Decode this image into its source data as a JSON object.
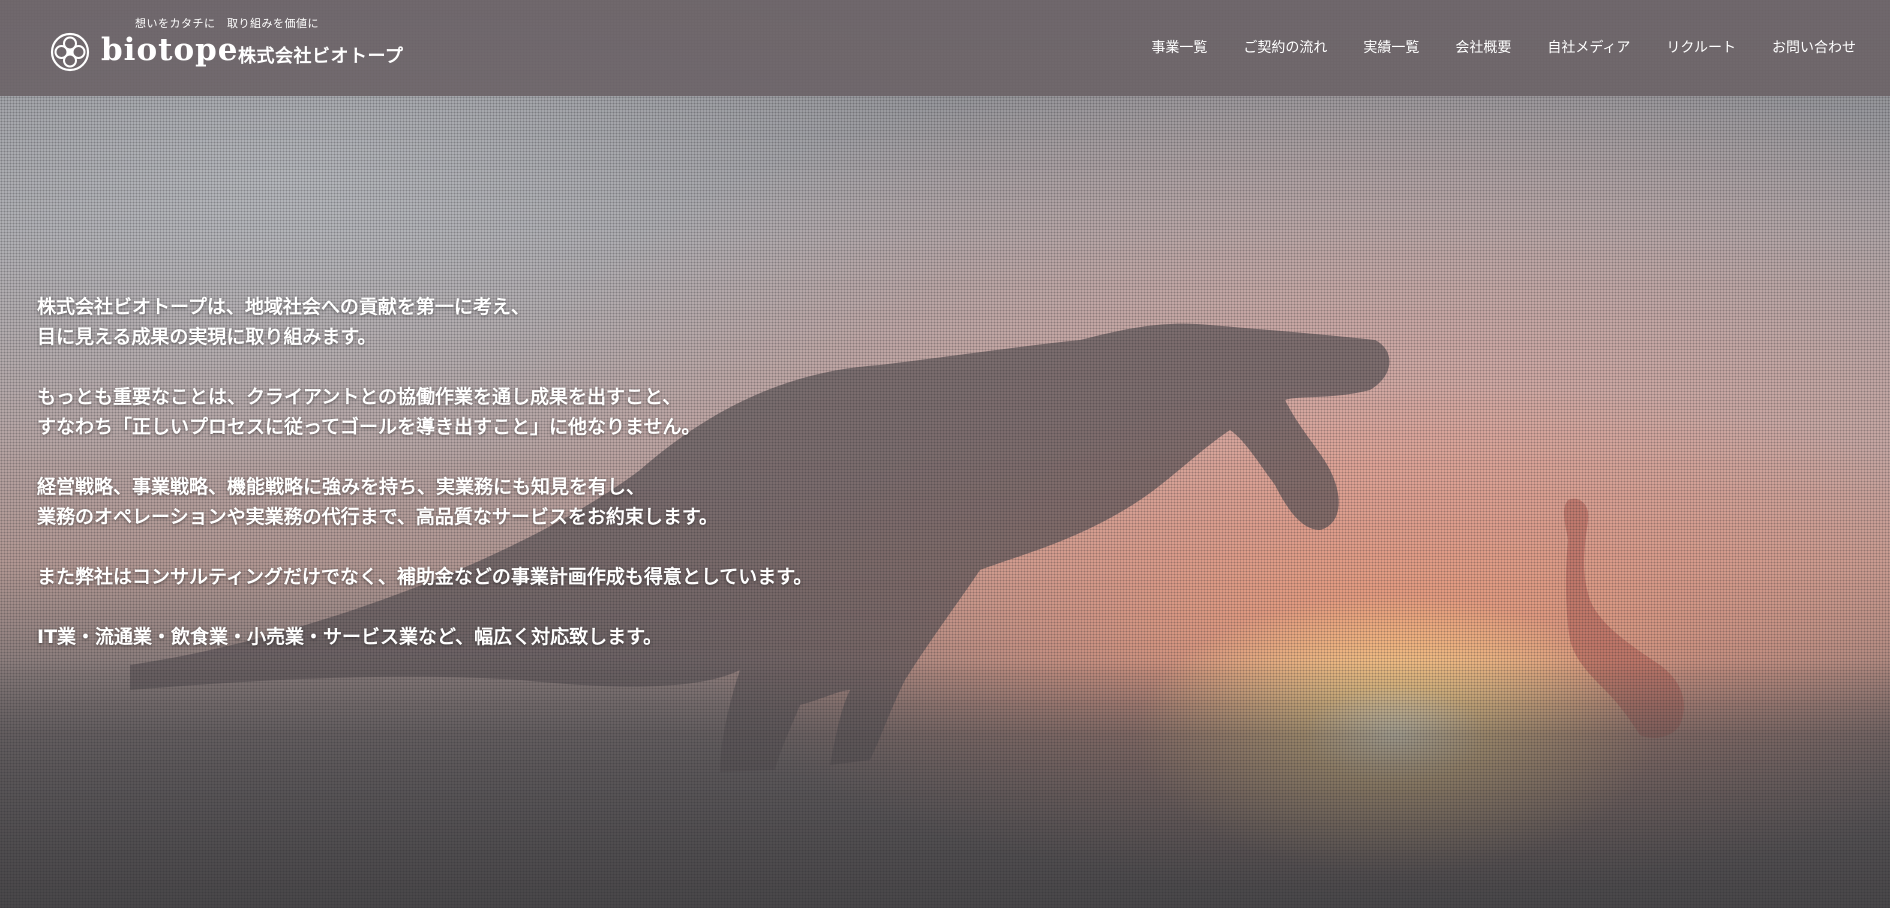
{
  "header": {
    "tagline": "想いをカタチに　取り組みを価値に",
    "logo_text": "biotope",
    "logo_icon": "biotope-knot-logo-icon",
    "company_name": "株式会社ビオトープ",
    "background_color": "#6c6468"
  },
  "nav": {
    "items": [
      {
        "label": "事業一覧"
      },
      {
        "label": "ご契約の流れ"
      },
      {
        "label": "実績一覧"
      },
      {
        "label": "会社概要"
      },
      {
        "label": "自社メディア"
      },
      {
        "label": "リクルート"
      },
      {
        "label": "お問い合わせ"
      }
    ]
  },
  "hero": {
    "background": "sunset-dinosaur-photo",
    "paragraphs": [
      {
        "lines": [
          "株式会社ビオトープは、地域社会への貢献を第一に考え、",
          "目に見える成果の実現に取り組みます。"
        ]
      },
      {
        "lines": [
          "もっとも重要なことは、クライアントとの協働作業を通し成果を出すこと、",
          "すなわち「正しいプロセスに従ってゴールを導き出すこと」に他なりません。"
        ]
      },
      {
        "lines": [
          "経営戦略、事業戦略、機能戦略に強みを持ち、実業務にも知見を有し、",
          "業務のオペレーションや実業務の代行まで、高品質なサービスをお約束します。"
        ]
      },
      {
        "lines": [
          "また弊社はコンサルティングだけでなく、補助金などの事業計画作成も得意としています。"
        ]
      },
      {
        "lines": [
          "IT業・流通業・飲食業・小売業・サービス業など、幅広く対応致します。"
        ]
      }
    ]
  }
}
